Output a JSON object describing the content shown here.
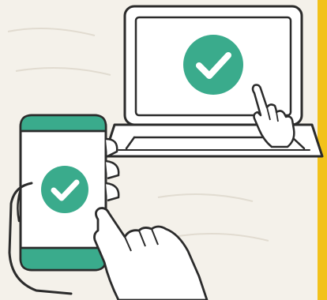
{
  "colors": {
    "paper": "#f4f1ea",
    "ink": "#2b2b2b",
    "teal": "#3aab8c",
    "white": "#ffffff",
    "accent": "#f2c21b"
  },
  "illustration": {
    "laptop": {
      "icon": "check-circle-icon",
      "hand": "tapping-hand-icon"
    },
    "phone": {
      "icon": "check-circle-icon",
      "hand": "tapping-hand-icon"
    }
  }
}
